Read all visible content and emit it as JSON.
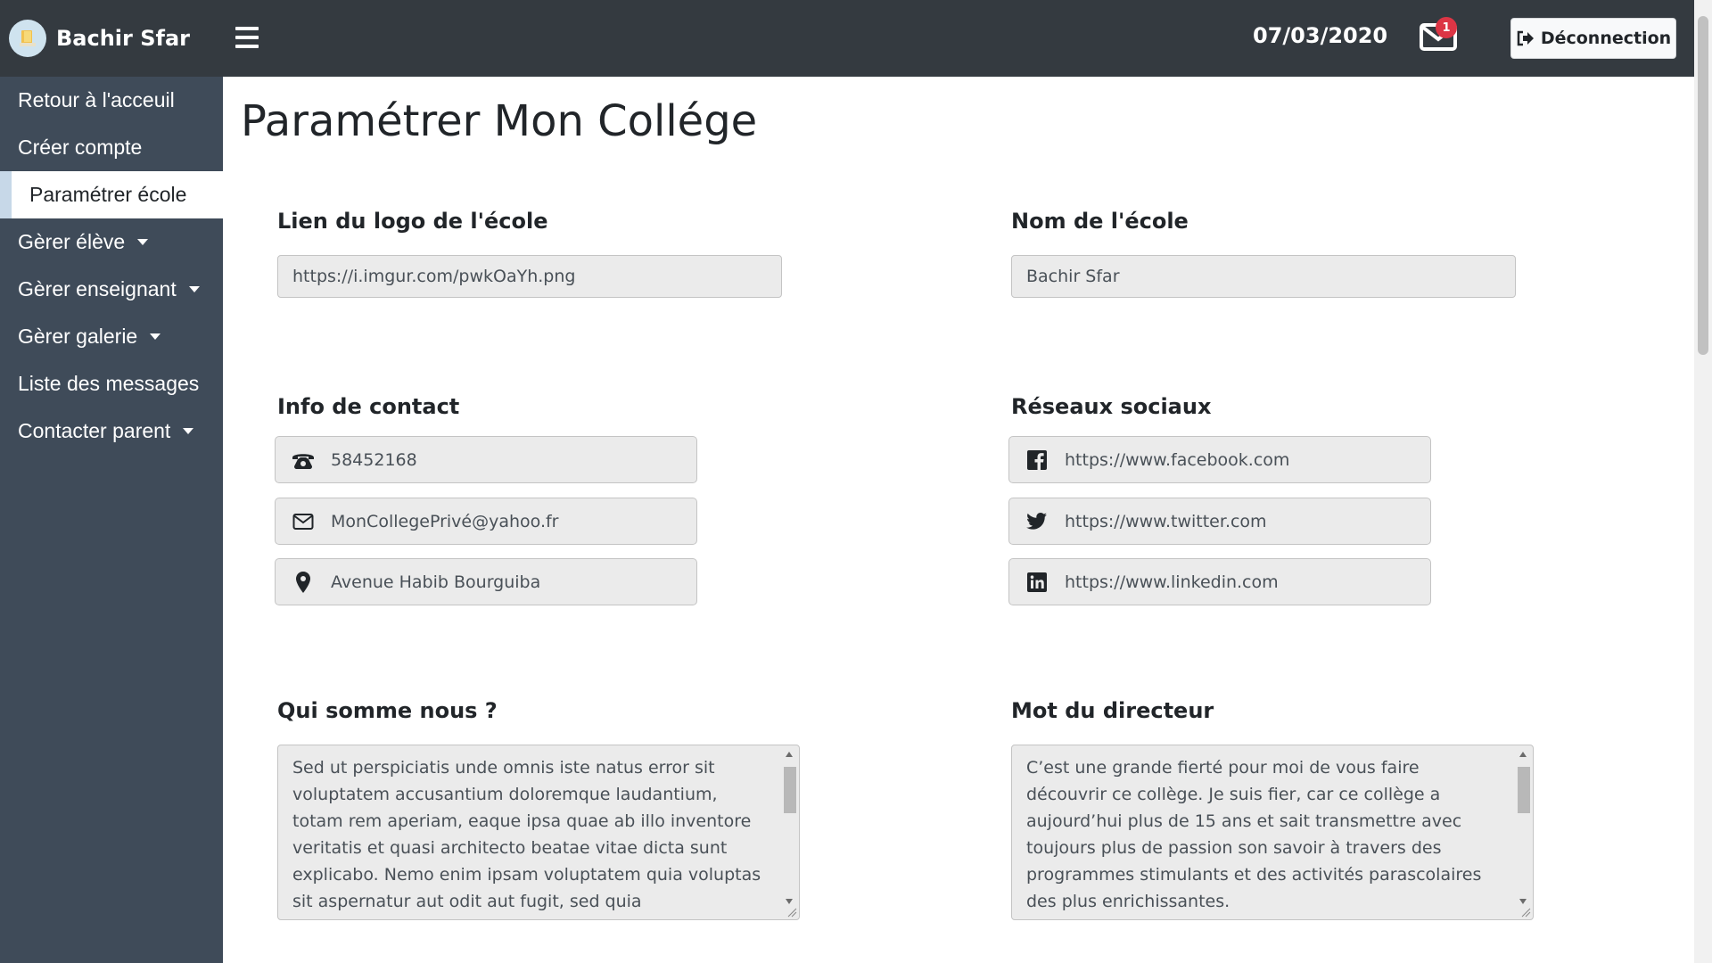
{
  "header": {
    "brand_name": "Bachir Sfar",
    "menu_icon": "hamburger-icon",
    "date": "07/03/2020",
    "mail_icon": "envelope-icon",
    "mail_count": "1",
    "logout_label": "Déconnection",
    "logout_icon": "sign-out-icon"
  },
  "sidebar": {
    "items": [
      {
        "label": "Retour à l'acceuil",
        "dropdown": false
      },
      {
        "label": "Créer compte",
        "dropdown": false
      },
      {
        "label": "Paramétrer école",
        "dropdown": false,
        "active": true
      },
      {
        "label": "Gèrer élève",
        "dropdown": true
      },
      {
        "label": "Gèrer enseignant",
        "dropdown": true
      },
      {
        "label": "Gèrer galerie",
        "dropdown": true
      },
      {
        "label": "Liste des messages",
        "dropdown": false
      },
      {
        "label": "Contacter parent",
        "dropdown": true
      }
    ]
  },
  "main": {
    "title": "Paramétrer Mon Collége",
    "logo": {
      "label": "Lien du logo de l'école",
      "value": "https://i.imgur.com/pwkOaYh.png"
    },
    "school_name": {
      "label": "Nom de l'école",
      "value": "Bachir Sfar"
    },
    "contact": {
      "label": "Info de contact",
      "phone": "58452168",
      "email": "MonCollegePrivé@yahoo.fr",
      "address": "Avenue Habib Bourguiba"
    },
    "social": {
      "label": "Réseaux sociaux",
      "facebook": "https://www.facebook.com",
      "twitter": "https://www.twitter.com",
      "linkedin": "https://www.linkedin.com"
    },
    "about": {
      "label": "Qui somme nous ?",
      "text": "Sed ut perspiciatis unde omnis iste natus error sit voluptatem accusantium doloremque laudantium, totam rem aperiam, eaque ipsa quae ab illo inventore veritatis et quasi architecto beatae vitae dicta sunt explicabo. Nemo enim ipsam voluptatem quia voluptas sit aspernatur aut odit aut fugit, sed quia consequuntur magni dolores eos qui"
    },
    "director": {
      "label": "Mot du directeur",
      "text": "C’est une grande fierté pour moi de vous faire découvrir ce collège. Je suis fier, car ce collège a aujourd’hui plus de 15 ans et sait transmettre avec toujours plus de passion son savoir à travers des programmes stimulants et des activités parascolaires des plus enrichissantes.\nLa variété des programmes, des activités et des sports"
    }
  }
}
